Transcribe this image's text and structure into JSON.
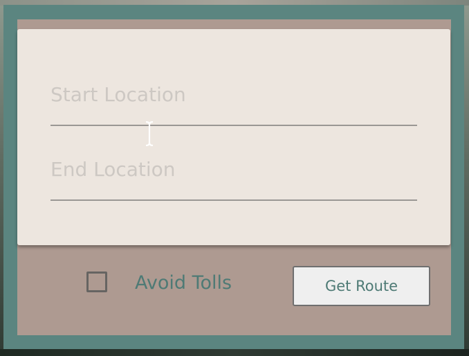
{
  "form": {
    "start_location": {
      "placeholder": "Start Location",
      "value": ""
    },
    "end_location": {
      "placeholder": "End Location",
      "value": ""
    },
    "avoid_tolls": {
      "label": "Avoid Tolls",
      "checked": false
    },
    "submit_label": "Get Route"
  },
  "colors": {
    "frame": "#5b8580",
    "panel": "#ae9a91",
    "card": "#ede6df",
    "accent_text": "#4e7a75",
    "placeholder": "#cdc8c3"
  },
  "icons": {
    "cursor": "text-cursor-icon"
  }
}
